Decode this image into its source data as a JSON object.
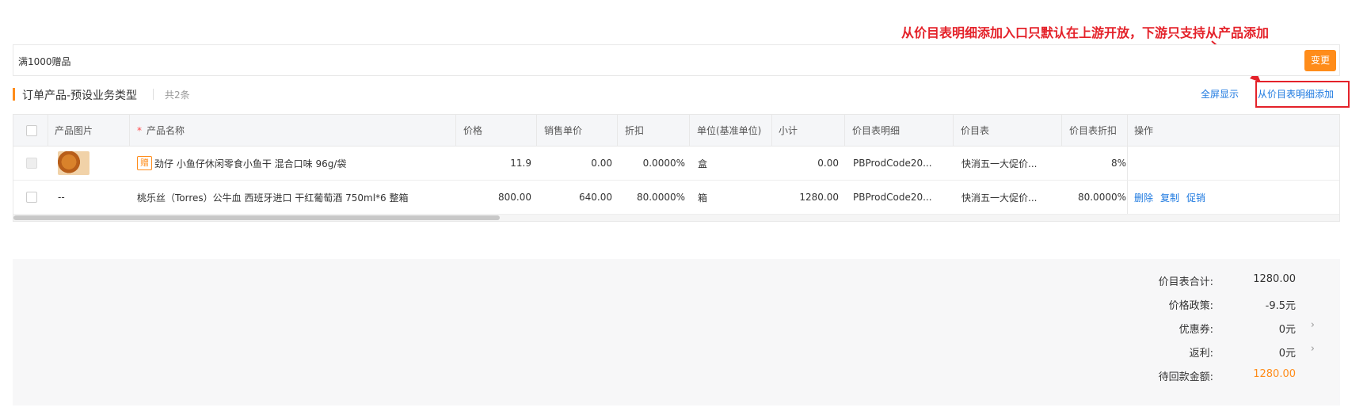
{
  "annotation": {
    "text": "从价目表明细添加入口只默认在上游开放，下游只支持从产品添加"
  },
  "gift_bar": {
    "text": "满1000赠品",
    "change_label": "变更"
  },
  "section": {
    "title": "订单产品-预设业务类型",
    "count": "共2条",
    "fullscreen_label": "全屏显示",
    "add_from_price_label": "从价目表明细添加"
  },
  "table": {
    "headers": [
      "产品图片",
      "产品名称",
      "价格",
      "销售单价",
      "折扣",
      "单位(基准单位)",
      "小计",
      "价目表明细",
      "价目表",
      "价目表折扣",
      "操作"
    ],
    "required_mark": "*",
    "rows": [
      {
        "image": "product-thumbnail",
        "tag": "赠",
        "name": "劲仔 小鱼仔休闲零食小鱼干 混合口味 96g/袋",
        "price": "11.9",
        "sale_price": "0.00",
        "discount": "0.0000%",
        "unit": "盒",
        "subtotal": "0.00",
        "price_detail": "PBProdCode20...",
        "price_book": "快消五一大促价...",
        "price_book_discount": "8%",
        "actions": []
      },
      {
        "image": "--",
        "tag": "",
        "name": "桃乐丝（Torres）公牛血 西班牙进口 干红葡萄酒 750ml*6 整箱",
        "price": "800.00",
        "sale_price": "640.00",
        "discount": "80.0000%",
        "unit": "箱",
        "subtotal": "1280.00",
        "price_detail": "PBProdCode20...",
        "price_book": "快消五一大促价...",
        "price_book_discount": "80.0000%",
        "actions": [
          "删除",
          "复制",
          "促销"
        ]
      }
    ]
  },
  "summary": {
    "rows": [
      {
        "label": "价目表合计:",
        "value": "1280.00",
        "chevron": false,
        "highlight": false
      },
      {
        "label": "价格政策:",
        "value": "-9.5元",
        "chevron": false,
        "highlight": false
      },
      {
        "label": "优惠券:",
        "value": "0元",
        "chevron": true,
        "highlight": false
      },
      {
        "label": "返利:",
        "value": "0元",
        "chevron": true,
        "highlight": false
      },
      {
        "label": "待回款金额:",
        "value": "1280.00",
        "chevron": false,
        "highlight": true
      }
    ],
    "chevron_glyph": "›"
  },
  "colors": {
    "accent": "#ff8c1a",
    "link": "#1f7ae0",
    "annotation": "#e4222a"
  }
}
